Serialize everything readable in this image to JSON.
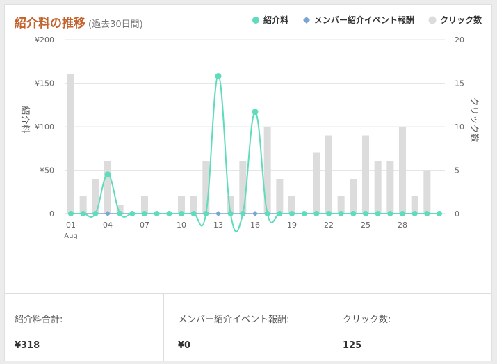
{
  "header": {
    "title": "紹介料の推移",
    "subtitle": "(過去30日間)"
  },
  "legend": [
    {
      "label": "紹介料",
      "marker": "dot-icon",
      "color": "#5fdcbb"
    },
    {
      "label": "メンバー紹介イベント報酬",
      "marker": "diamond-icon",
      "color": "#7aa3d6"
    },
    {
      "label": "クリック数",
      "marker": "dot-icon",
      "color": "#dcdcdc"
    }
  ],
  "summary": [
    {
      "label": "紹介料合計:",
      "value": "¥318"
    },
    {
      "label": "メンバー紹介イベント報酬:",
      "value": "¥0"
    },
    {
      "label": "クリック数:",
      "value": "125"
    }
  ],
  "chart_data": {
    "type": "bar",
    "ylabel": "紹介料",
    "y2label": "クリック数",
    "ylim": [
      0,
      200
    ],
    "y2lim": [
      0,
      20
    ],
    "yticks": [
      "0",
      "¥50",
      "¥100",
      "¥150",
      "¥200"
    ],
    "y2ticks": [
      "0",
      "5",
      "10",
      "15",
      "20"
    ],
    "x": [
      1,
      2,
      3,
      4,
      5,
      6,
      7,
      8,
      9,
      10,
      11,
      12,
      13,
      14,
      15,
      16,
      17,
      18,
      19,
      20,
      21,
      22,
      23,
      24,
      25,
      26,
      27,
      28,
      29,
      30,
      31
    ],
    "xticks": [
      {
        "day": 1,
        "label": "01",
        "sublabel": "Aug"
      },
      {
        "day": 4,
        "label": "04"
      },
      {
        "day": 7,
        "label": "07"
      },
      {
        "day": 10,
        "label": "10"
      },
      {
        "day": 13,
        "label": "13"
      },
      {
        "day": 16,
        "label": "16"
      },
      {
        "day": 19,
        "label": "19"
      },
      {
        "day": 22,
        "label": "22"
      },
      {
        "day": 25,
        "label": "25"
      },
      {
        "day": 28,
        "label": "28"
      }
    ],
    "series": [
      {
        "name": "クリック数",
        "type": "bar",
        "axis": "right",
        "color": "#dcdcdc",
        "values": [
          16,
          2,
          4,
          6,
          1,
          0,
          2,
          0,
          0,
          2,
          2,
          6,
          0,
          2,
          6,
          0,
          10,
          4,
          2,
          0,
          7,
          9,
          2,
          4,
          9,
          6,
          6,
          10,
          2,
          5,
          0
        ]
      },
      {
        "name": "紹介料",
        "type": "line",
        "axis": "left",
        "color": "#5fdcbb",
        "values": [
          0,
          0,
          0,
          45,
          0,
          0,
          0,
          0,
          0,
          0,
          0,
          0,
          158,
          0,
          0,
          117,
          0,
          0,
          0,
          0,
          0,
          0,
          0,
          0,
          0,
          0,
          0,
          0,
          0,
          0,
          0
        ]
      },
      {
        "name": "メンバー紹介イベント報酬",
        "type": "line",
        "axis": "left",
        "color": "#7aa3d6",
        "values": [
          0,
          0,
          0,
          0,
          0,
          0,
          0,
          0,
          0,
          0,
          0,
          0,
          0,
          0,
          0,
          0,
          0,
          0,
          0,
          0,
          0,
          0,
          0,
          0,
          0,
          0,
          0,
          0,
          0,
          0,
          0
        ]
      }
    ]
  }
}
